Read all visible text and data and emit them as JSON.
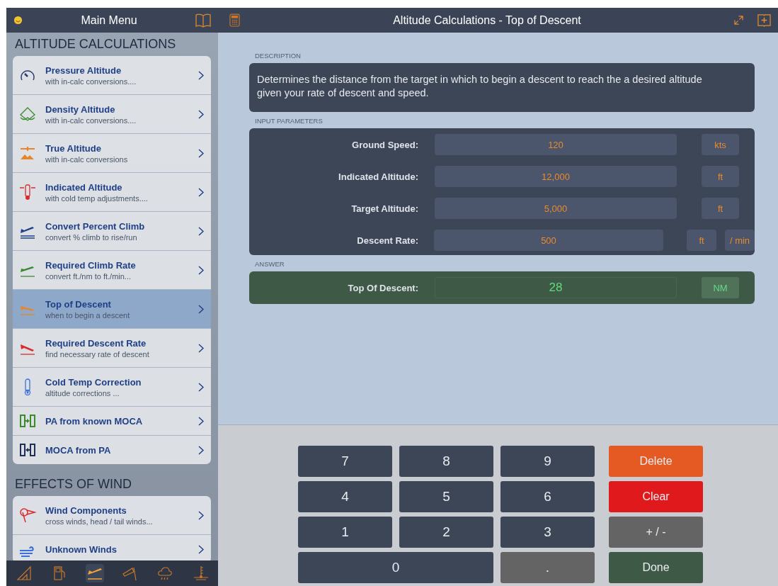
{
  "sidebar": {
    "title": "Main Menu",
    "sections": [
      {
        "heading": "ALTITUDE CALCULATIONS",
        "items": [
          {
            "title": "Pressure Altitude",
            "subtitle": "with in-calc conversions....",
            "selected": false,
            "color": "#2b3f6e"
          },
          {
            "title": "Density Altitude",
            "subtitle": "with in-calc conversions....",
            "selected": false,
            "color": "#3b8a2e"
          },
          {
            "title": "True Altitude",
            "subtitle": "with in-calc conversions",
            "selected": false,
            "color": "#e8842a"
          },
          {
            "title": "Indicated Altitude",
            "subtitle": "with cold temp adjustments....",
            "selected": false,
            "color": "#d92b2b"
          },
          {
            "title": "Convert Percent Climb",
            "subtitle": "convert % climb to rise/run",
            "selected": false,
            "color": "#1f3f86"
          },
          {
            "title": "Required Climb Rate",
            "subtitle": "convert ft./nm to ft./min...",
            "selected": false,
            "color": "#3b8a2e"
          },
          {
            "title": "Top of Descent",
            "subtitle": "when to begin a descent",
            "selected": true,
            "color": "#e8842a"
          },
          {
            "title": "Required Descent Rate",
            "subtitle": "find necessary rate of descent",
            "selected": false,
            "color": "#d92b2b"
          },
          {
            "title": "Cold Temp Correction",
            "subtitle": "altitude corrections ...",
            "selected": false,
            "color": "#3b6fd9"
          },
          {
            "title": "PA from known MOCA",
            "selected": false,
            "color": "#3b8a2e"
          },
          {
            "title": "MOCA from PA",
            "selected": false,
            "color": "#1f2f56"
          }
        ]
      },
      {
        "heading": "EFFECTS OF WIND",
        "items": [
          {
            "title": "Wind Components",
            "subtitle": "cross winds, head / tail winds...",
            "selected": false,
            "color": "#d92b2b"
          },
          {
            "title": "Unknown Winds",
            "selected": false,
            "color": "#3b6fd9"
          }
        ]
      }
    ],
    "tab_bar": [
      {
        "selected": false
      },
      {
        "selected": false
      },
      {
        "selected": true
      },
      {
        "selected": false
      },
      {
        "selected": false
      },
      {
        "selected": false
      }
    ]
  },
  "main": {
    "title": "Altitude Calculations - Top of Descent",
    "description": {
      "label": "DESCRIPTION",
      "text": "Determines the distance from the target in which to begin a descent to reach the a desired altitude given your rate of descent and speed."
    },
    "inputs": {
      "label": "INPUT PARAMETERS",
      "rows": [
        {
          "label": "Ground Speed:",
          "value": "120",
          "units": [
            "kts"
          ]
        },
        {
          "label": "Indicated Altitude:",
          "value": "12,000",
          "units": [
            "ft"
          ]
        },
        {
          "label": "Target Altitude:",
          "value": "5,000",
          "units": [
            "ft"
          ]
        },
        {
          "label": "Descent Rate:",
          "value": "500",
          "units": [
            "ft",
            "/ min"
          ]
        }
      ]
    },
    "answer": {
      "label": "ANSWER",
      "row": {
        "label": "Top Of Descent:",
        "value": "28",
        "unit": "NM"
      }
    },
    "keypad": [
      {
        "label": "7",
        "kind": "digit"
      },
      {
        "label": "8",
        "kind": "digit"
      },
      {
        "label": "9",
        "kind": "digit"
      },
      {
        "label": "Delete",
        "kind": "delete"
      },
      {
        "label": "4",
        "kind": "digit"
      },
      {
        "label": "5",
        "kind": "digit"
      },
      {
        "label": "6",
        "kind": "digit"
      },
      {
        "label": "Clear",
        "kind": "clear"
      },
      {
        "label": "1",
        "kind": "digit"
      },
      {
        "label": "2",
        "kind": "digit"
      },
      {
        "label": "3",
        "kind": "digit"
      },
      {
        "label": "+ / -",
        "kind": "sign"
      },
      {
        "label": "0",
        "kind": "zero"
      },
      {
        "label": ".",
        "kind": "dot"
      },
      {
        "label": "Done",
        "kind": "done"
      }
    ]
  }
}
